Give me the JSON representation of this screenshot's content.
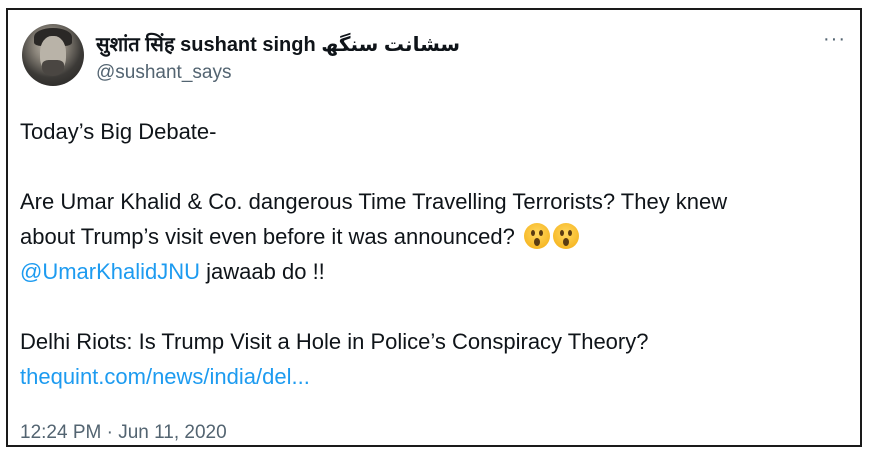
{
  "user": {
    "display_name": "सुशांत सिंह sushant singh سشانت سنگھ",
    "handle": "@sushant_says"
  },
  "more_label": "···",
  "tweet": {
    "line1": "Today’s Big Debate-",
    "line2": "Are Umar Khalid & Co. dangerous Time Travelling Terrorists? They knew",
    "line3": "about Trump’s visit even before it was announced?",
    "mention": "@UmarKhalidJNU",
    "mention_rest": " jawaab do !!",
    "line5": "Delhi Riots: Is Trump Visit a Hole in Police’s Conspiracy Theory?",
    "link": "thequint.com/news/india/del..."
  },
  "emojis": [
    "hushed-face-emoji",
    "hushed-face-emoji"
  ],
  "timestamp": "12:24 PM · Jun 11, 2020"
}
